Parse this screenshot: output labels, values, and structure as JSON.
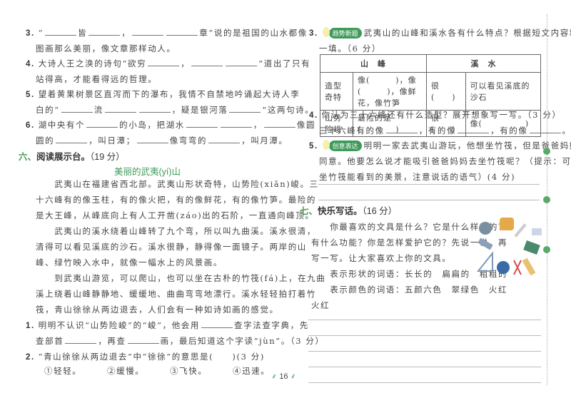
{
  "left": {
    "questions_top": [
      {
        "num": "3.",
        "lines": [
          "“___皆___，______章”说的是祖国的山水都像",
          "图画那么美丽，像文章那样动人。"
        ]
      },
      {
        "num": "4.",
        "lines": [
          "大诗人王之涣的诗句“欲穷___，______”道出了只有",
          "站得高，才能看得远的哲理。"
        ]
      },
      {
        "num": "5.",
        "lines": [
          "望着黄果树景区直泻而下的瀑布，我情不自禁地吟诵起大诗人李",
          "白的“___流______，疑是银河落___”这两句诗。"
        ]
      },
      {
        "num": "6.",
        "lines": [
          "湖中央有个___的小岛，把湖水______，___像圆",
          "圆的___，叫日潭；___像弯弯的___，叫月潭。"
        ]
      }
    ],
    "section6": {
      "num": "六、",
      "label": "阅读展示台。",
      "score": "（19 分）"
    },
    "passage_title": "美丽的武夷(yí)山",
    "passage_lines": [
      "　　武夷山在福建省西北部。武夷山形状奇特，山势险(xiǎn)峻。三",
      "十六峰有的像玉柱，有的像火把，有的像鲜花，有的像竹笋。最险的",
      "是大王峰，从峰底向上有人工开凿(záo)出的石阶，一直通向峰顶。",
      "　　武夷山的溪水绕着山峰转了九个弯，所以叫九曲溪。溪水很清，",
      "清得可以看见溪底的沙石。溪水很静，静得像一面镜子。两岸的山",
      "峰、绿竹映入水中，就像一幅水上的风景画。",
      "　　到武夷山游览，可以爬山，也可以坐在古朴的竹筏(fá)上，在九曲",
      "溪上绕着山峰静静地、缓缓地、曲曲弯弯地漂行。溪水轻轻拍打着竹",
      "筏，青山徐徐从两边退去，人们会有一种如诗如画的感觉。"
    ],
    "q1": {
      "num": "1.",
      "lines": [
        "明明不认识“山势险峻”的“峻”，他会用___查字法查字典，先",
        "查部首___，再查___画，最后知道这个字读“jùn”。（3 分）"
      ]
    },
    "q2": {
      "num": "2.",
      "text": "“青山徐徐从两边退去”中“徐徐”的意思是(　　)(3 分)"
    },
    "q2_options": [
      "①轻轻。",
      "②缓慢。",
      "③飞快。",
      "④迅速。"
    ]
  },
  "right": {
    "q3": {
      "num": "3.",
      "badge": "趋势新题",
      "lines": [
        "武夷山的山峰和溪水各有什么特点？根据短文内容填",
        "一填。（6 分）"
      ]
    },
    "table": {
      "headers": [
        "山　峰",
        "溪　水"
      ],
      "rows": [
        [
          "造型奇特",
          "像(　　　)，像(　　　)，像鲜花，像竹笋",
          "很(　　)",
          "可以看见溪底的沙石"
        ],
        [
          "山势险峻",
          "最险的是(　　　　)",
          "很(　　)",
          "像(　　　　　)"
        ]
      ]
    },
    "q4": {
      "num": "4.",
      "lines": [
        "你认为三十六峰还有什么造型？展开想象写一写。（3 分）",
        "三十六峰有的像___，有的像___，有的像___。"
      ]
    },
    "q5": {
      "num": "5.",
      "badge": "创意表达",
      "lines": [
        "明明一家去武夷山游玩，他想坐竹筏，但是爸爸妈妈不",
        "同意。他要怎么说才能吸引爸爸妈妈去坐竹筏呢？（提示：可以写",
        "坐竹筏能看到的美景，注意说话的语气）(4 分)"
      ]
    },
    "section7": {
      "num": "七、",
      "label": "快乐写话。",
      "score": "（16 分）"
    },
    "writing_lines": [
      "　　你最喜欢的文具是什么？它是什么样子的？",
      "有什么功能？你是怎样爱护它的？先说一说，再",
      "写一写。让大家喜欢上你的文具。",
      "　　表示形状的词语：长长的　扁扁的　粗粗的",
      "　　表示颜色的词语：五颜六色　翠绿色　火红",
      "火红"
    ]
  },
  "page_number": "16"
}
